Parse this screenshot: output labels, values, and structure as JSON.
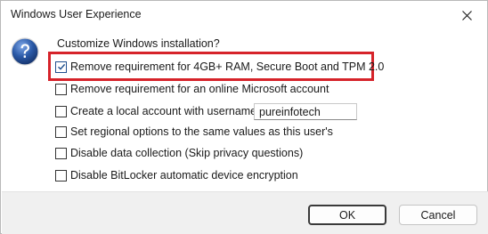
{
  "window": {
    "title": "Windows User Experience"
  },
  "icons": {
    "dialog_icon": "question-icon",
    "close": "close-icon"
  },
  "dialog": {
    "heading": "Customize Windows installation?",
    "options": [
      {
        "label": "Remove requirement for 4GB+ RAM, Secure Boot and TPM 2.0",
        "checked": true,
        "highlighted": true
      },
      {
        "label": "Remove requirement for an online Microsoft account",
        "checked": false
      },
      {
        "label": "Create a local account with username:",
        "checked": false
      },
      {
        "label": "Set regional options to the same values as this user's",
        "checked": false
      },
      {
        "label": "Disable data collection (Skip privacy questions)",
        "checked": false
      },
      {
        "label": "Disable BitLocker automatic device encryption",
        "checked": false
      }
    ],
    "username_value": "pureinfotech"
  },
  "buttons": {
    "ok_label": "OK",
    "cancel_label": "Cancel"
  },
  "colors": {
    "highlight_border": "#d6232a",
    "checkbox_check": "#1f4f8f",
    "icon_blue": "#2b5aa8"
  }
}
